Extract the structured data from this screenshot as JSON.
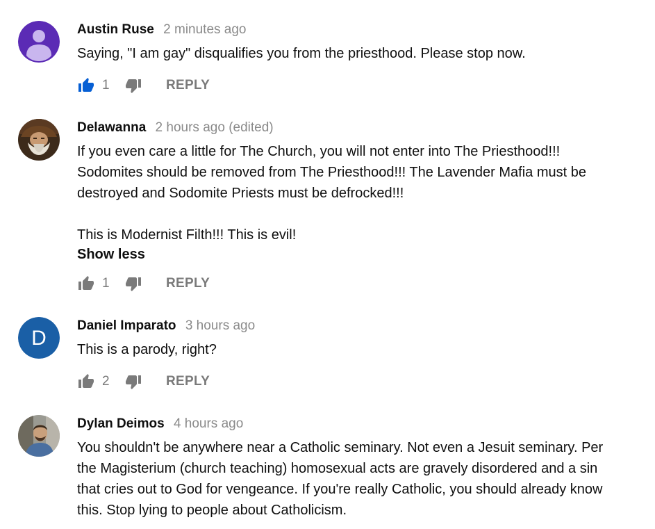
{
  "comments": [
    {
      "author": "Austin Ruse",
      "timestamp": "2 minutes ago",
      "edited": "",
      "text": [
        "Saying, \"I am gay\" disqualifies you from the priesthood. Please stop now."
      ],
      "likes": "1",
      "liked": true,
      "reply_label": "REPLY",
      "avatar": {
        "type": "default-person",
        "color": "#5b2bb5"
      }
    },
    {
      "author": "Delawanna",
      "timestamp": "2 hours ago",
      "edited": "(edited)",
      "text": [
        "If you even care a little for The Church, you will not enter into The Priesthood!!!",
        "Sodomites should be removed from The Priesthood!!! The Lavender Mafia must be",
        "destroyed and Sodomite Priests must be defrocked!!!",
        "This is Modernist Filth!!! This is evil!"
      ],
      "show_less": "Show less",
      "likes": "1",
      "liked": false,
      "reply_label": "REPLY",
      "avatar": {
        "type": "photo-bearded-man"
      }
    },
    {
      "author": "Daniel Imparato",
      "timestamp": "3 hours ago",
      "edited": "",
      "text": [
        "This is a parody, right?"
      ],
      "likes": "2",
      "liked": false,
      "reply_label": "REPLY",
      "avatar": {
        "type": "letter",
        "letter": "D",
        "color": "#1a5fa6"
      }
    },
    {
      "author": "Dylan Deimos",
      "timestamp": "4 hours ago",
      "edited": "",
      "text": [
        "You shouldn't be anywhere near a Catholic seminary. Not even a Jesuit seminary. Per",
        "the Magisterium (church teaching) homosexual acts are gravely disordered and a sin",
        "that cries out to God for vengeance. If you're really Catholic, you should already know",
        "this. Stop lying to people about Catholicism."
      ],
      "avatar": {
        "type": "photo-man-outdoors"
      }
    }
  ],
  "colors": {
    "like_active": "#065fd4",
    "icon_inactive": "#7a7a7a",
    "secondary_text": "#8a8a8a"
  }
}
